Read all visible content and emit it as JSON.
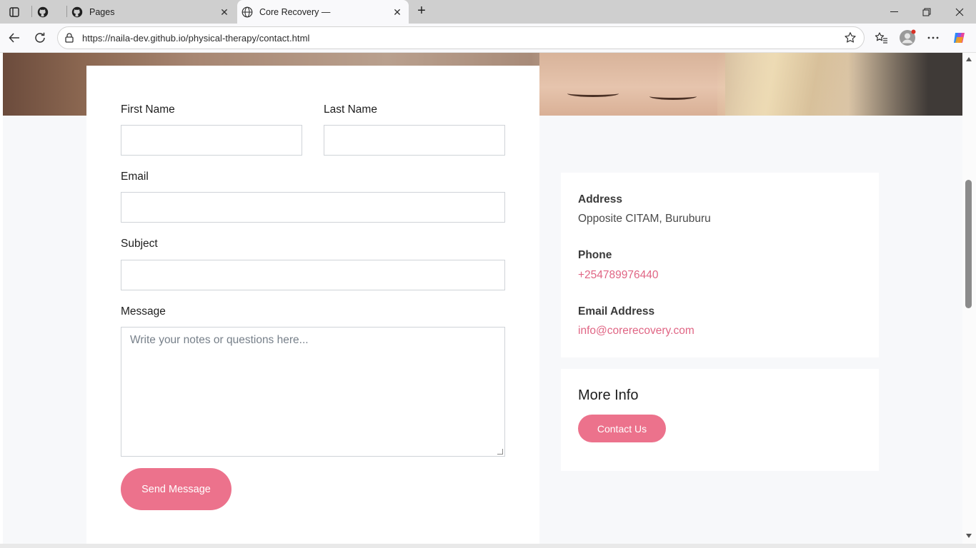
{
  "browser": {
    "tabs": [
      {
        "label": "",
        "icon": "github-icon"
      },
      {
        "label": "Pages",
        "icon": "github-icon"
      },
      {
        "label": "Core Recovery —",
        "icon": "globe-icon",
        "active": true
      }
    ],
    "url": "https://naila-dev.github.io/physical-therapy/contact.html"
  },
  "form": {
    "first_name_label": "First Name",
    "last_name_label": "Last Name",
    "email_label": "Email",
    "subject_label": "Subject",
    "message_label": "Message",
    "message_placeholder": "Write your notes or questions here...",
    "send_button": "Send Message"
  },
  "info": {
    "address_heading": "Address",
    "address_value": "Opposite CITAM, Buruburu",
    "phone_heading": "Phone",
    "phone_value": "+254789976440",
    "email_heading": "Email Address",
    "email_value": "info@corerecovery.com"
  },
  "more_info": {
    "title": "More Info",
    "contact_button": "Contact Us"
  },
  "colors": {
    "accent": "#ec728c",
    "link": "#e06584",
    "page_bg": "#f7f8fa"
  }
}
